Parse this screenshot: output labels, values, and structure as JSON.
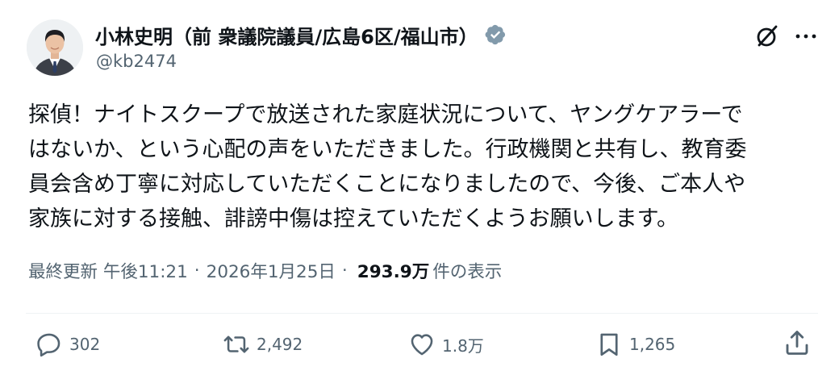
{
  "author": {
    "name": "小林史明（前 衆議院議員/広島6区/福山市）",
    "handle": "@kb2474"
  },
  "tweet": {
    "lines": [
      "探偵！ナイトスクープで放送された家庭状況について、ヤングケアラーで",
      "はないか、という心配の声をいただきました。行政機関と共有し、教育委",
      "員会含め丁寧に対応していただくことになりましたので、今後、ご本人や",
      "家族に対する接触、誹謗中傷は控えていただくようお願いします。"
    ]
  },
  "meta": {
    "updated_label": "最終更新 午後11:21",
    "separator": "·",
    "date": "2026年1月25日",
    "views": "293.9万",
    "views_label": "件の表示"
  },
  "actions": {
    "reply_count": "302",
    "repost_count": "2,492",
    "like_count": "1.8万",
    "bookmark_count": "1,265"
  },
  "colors": {
    "text": "#0f1419",
    "secondary": "#536471",
    "verified_badge": "#829aab",
    "divider": "#eff3f4"
  },
  "icons": [
    "verified-badge-icon",
    "grok-icon",
    "more-icon",
    "reply-icon",
    "repost-icon",
    "like-icon",
    "bookmark-icon",
    "share-icon"
  ]
}
